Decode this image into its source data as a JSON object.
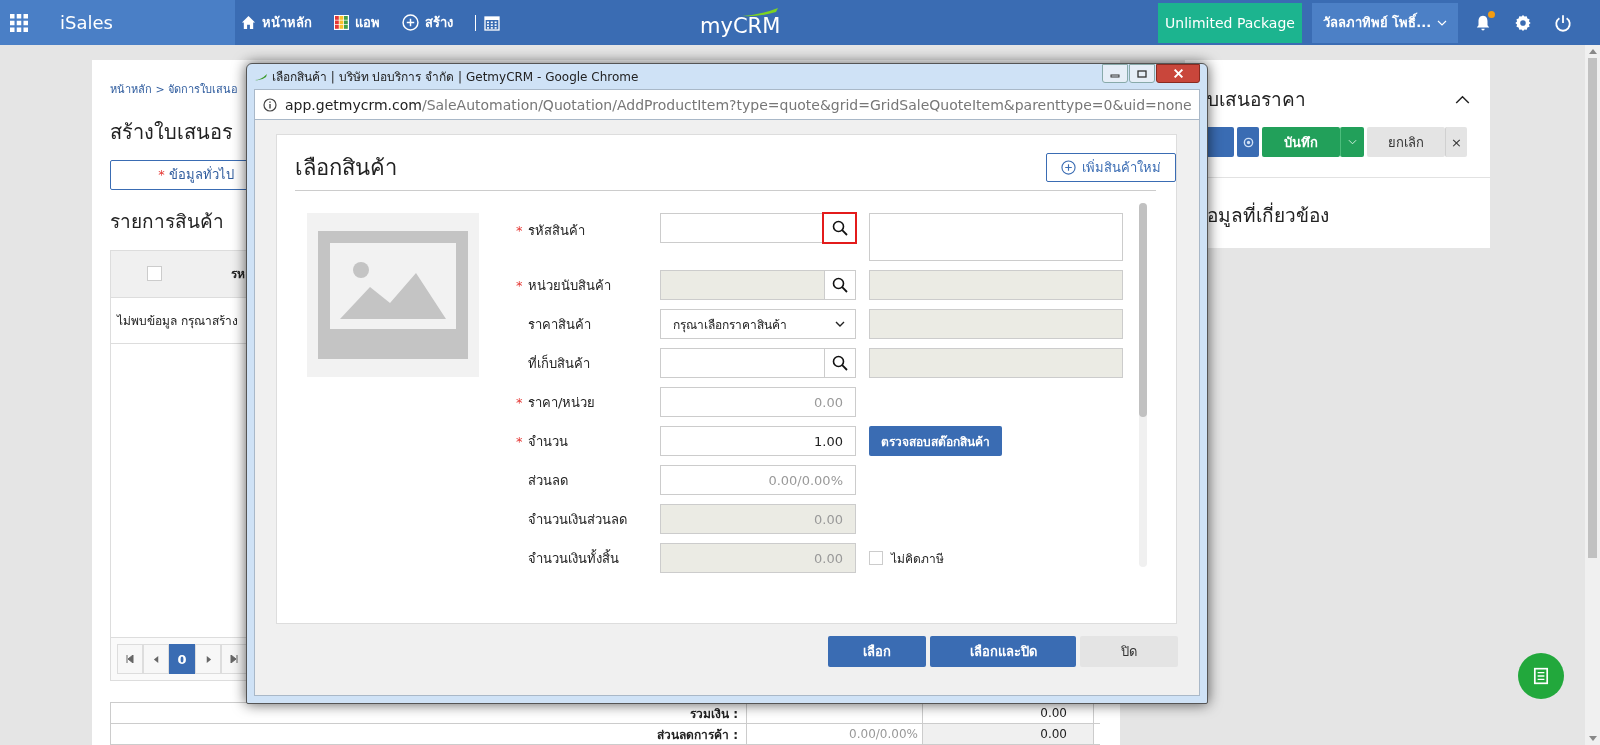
{
  "top_bar": {
    "app_name": "iSales",
    "nav": [
      {
        "kind": "home",
        "label": "หน้าหลัก"
      },
      {
        "kind": "apps",
        "label": "แอพ"
      },
      {
        "kind": "create",
        "label": "สร้าง"
      },
      {
        "kind": "calendar"
      }
    ],
    "logo": "myCRM",
    "package_button": "Unlimited Package",
    "user": "วัลลภาทิพย์ โพธิ์...",
    "notification_dot": true
  },
  "page": {
    "breadcrumb": "หน้าหลัก > จัดการใบเสนอ",
    "title": "สร้างใบเสนอร",
    "tab": {
      "required_mark": "*",
      "label": "ข้อมูลทั่วไป"
    },
    "section_title": "รายการสินค้า",
    "table": {
      "select_all_checked": false,
      "column_1": "รห",
      "empty_message": "ไม่พบข้อมูล กรุณาสร้าง"
    },
    "pager": {
      "page": "0"
    },
    "totals": [
      {
        "label": "รวมเงิน :",
        "amount": "0.00"
      },
      {
        "label": "ส่วนลดการค้า :",
        "discount": "0.00/0.00%",
        "amount": "0.00"
      }
    ]
  },
  "side_panel": {
    "title": "บเสนอราคา",
    "save_button": "บันทึก",
    "cancel_button": "ยกเลิก",
    "close_button": "×",
    "related_title": "อมูลที่เกี่ยวข้อง"
  },
  "popup": {
    "window_title": "เลือกสินค้า | บริษัท ปอบริการ จำกัด | GetmyCRM - Google Chrome",
    "url_host": "app.getmycrm.com",
    "url_path": "/SaleAutomation/Quotation/AddProductItem?type=quote&grid=GridSaleQuoteItem&parenttype=0&uid=none",
    "heading": "เลือกสินค้า",
    "add_button": "เพิ่มสินค้าใหม่",
    "fields": [
      {
        "label": "รหัสสินค้า",
        "required": true,
        "kind": "lookup",
        "disabled": false,
        "highlighted": true,
        "side": {
          "kind": "textarea"
        }
      },
      {
        "label": "หน่วยนับสินค้า",
        "required": true,
        "kind": "lookup",
        "disabled": true,
        "highlighted": false,
        "side": {
          "kind": "readonly"
        }
      },
      {
        "label": "ราคาสินค้า",
        "required": false,
        "kind": "select",
        "disabled": false,
        "value": "กรุณาเลือกราคาสินค้า",
        "side": {
          "kind": "readonly"
        }
      },
      {
        "label": "ที่เก็บสินค้า",
        "required": false,
        "kind": "lookup",
        "disabled": false,
        "highlighted": false,
        "side": {
          "kind": "readonly"
        }
      },
      {
        "label": "ราคา/หน่วย",
        "required": true,
        "kind": "number",
        "disabled": false,
        "placeholder": "0.00"
      },
      {
        "label": "จำนวน",
        "required": true,
        "kind": "number",
        "disabled": false,
        "value": "1.00",
        "side": {
          "kind": "button",
          "label": "ตรวจสอบสต๊อกสินค้า"
        }
      },
      {
        "label": "ส่วนลด",
        "required": false,
        "kind": "number",
        "disabled": false,
        "placeholder": "0.00/0.00%"
      },
      {
        "label": "จำนวนเงินส่วนลด",
        "required": false,
        "kind": "number",
        "disabled": true,
        "value": "0.00"
      },
      {
        "label": "จำนวนเงินทั้งสิ้น",
        "required": false,
        "kind": "number",
        "disabled": true,
        "value": "0.00",
        "side": {
          "kind": "checkbox",
          "label": "ไม่คิดภาษี",
          "checked": false
        }
      }
    ],
    "buttons": [
      {
        "kind": "primary",
        "label": "เลือก"
      },
      {
        "kind": "primary",
        "label": "เลือกและปิด"
      },
      {
        "kind": "secondary",
        "label": "ปิด"
      }
    ]
  }
}
